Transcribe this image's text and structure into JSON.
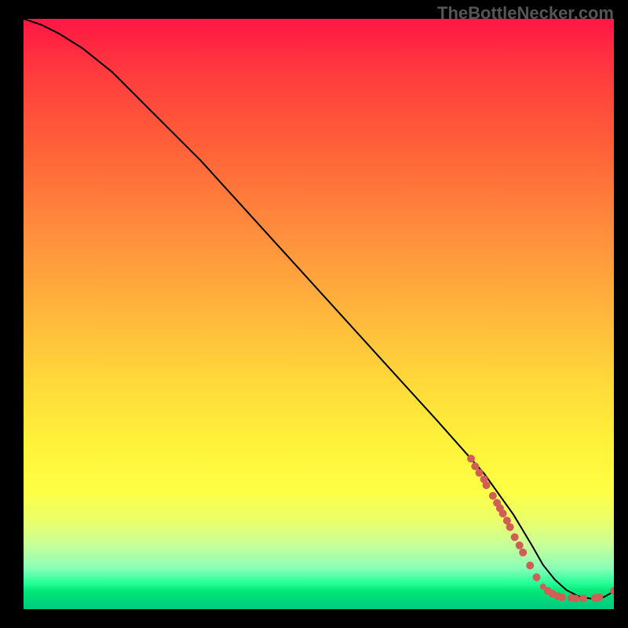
{
  "watermark": "TheBottleNecker.com",
  "chart_data": {
    "type": "line",
    "title": "",
    "xlabel": "",
    "ylabel": "",
    "xlim": [
      0,
      100
    ],
    "ylim": [
      0,
      100
    ],
    "series": [
      {
        "name": "curve",
        "x": [
          0,
          3,
          6,
          10,
          15,
          20,
          30,
          40,
          50,
          60,
          70,
          78,
          83,
          86,
          88,
          90,
          92,
          94,
          96,
          98,
          100
        ],
        "values": [
          100,
          99,
          97.5,
          95,
          91,
          86,
          76,
          65,
          54,
          43,
          32,
          23,
          16,
          11,
          7.5,
          5,
          3.2,
          2.2,
          1.8,
          1.9,
          3.0
        ]
      }
    ],
    "scatter": {
      "name": "highlight",
      "color": "#d15e54",
      "points": [
        {
          "x": 75.8,
          "y": 25.5,
          "r": 5
        },
        {
          "x": 76.5,
          "y": 24.2,
          "r": 5
        },
        {
          "x": 77.2,
          "y": 23.1,
          "r": 5
        },
        {
          "x": 78.0,
          "y": 22.0,
          "r": 5
        },
        {
          "x": 78.4,
          "y": 21.0,
          "r": 5
        },
        {
          "x": 79.5,
          "y": 19.2,
          "r": 5
        },
        {
          "x": 80.2,
          "y": 18.0,
          "r": 5
        },
        {
          "x": 80.7,
          "y": 17.1,
          "r": 5
        },
        {
          "x": 81.2,
          "y": 16.2,
          "r": 5
        },
        {
          "x": 81.9,
          "y": 15.0,
          "r": 5
        },
        {
          "x": 82.4,
          "y": 13.9,
          "r": 5
        },
        {
          "x": 83.2,
          "y": 12.2,
          "r": 5
        },
        {
          "x": 84.0,
          "y": 10.8,
          "r": 5
        },
        {
          "x": 84.6,
          "y": 9.6,
          "r": 5
        },
        {
          "x": 85.8,
          "y": 7.4,
          "r": 5
        },
        {
          "x": 86.9,
          "y": 5.4,
          "r": 5
        },
        {
          "x": 88.0,
          "y": 3.8,
          "r": 4
        },
        {
          "x": 88.8,
          "y": 3.1,
          "r": 5
        },
        {
          "x": 89.6,
          "y": 2.6,
          "r": 5
        },
        {
          "x": 90.5,
          "y": 2.2,
          "r": 5
        },
        {
          "x": 91.2,
          "y": 2.0,
          "r": 5
        },
        {
          "x": 92.8,
          "y": 1.9,
          "r": 5
        },
        {
          "x": 93.5,
          "y": 1.8,
          "r": 5
        },
        {
          "x": 94.8,
          "y": 1.8,
          "r": 5
        },
        {
          "x": 96.8,
          "y": 1.9,
          "r": 5
        },
        {
          "x": 97.5,
          "y": 2.0,
          "r": 5
        },
        {
          "x": 100,
          "y": 3.1,
          "r": 5
        }
      ]
    }
  }
}
